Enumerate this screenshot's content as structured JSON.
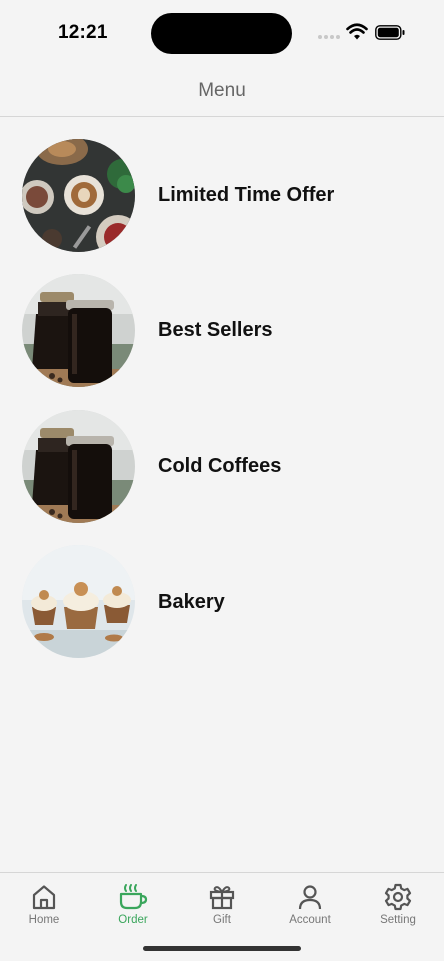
{
  "status_bar": {
    "time": "12:21"
  },
  "header": {
    "title": "Menu"
  },
  "menu": {
    "items": [
      {
        "label": "Limited Time Offer",
        "image": "coffee-table-photo"
      },
      {
        "label": "Best Sellers",
        "image": "cold-brew-jars-photo"
      },
      {
        "label": "Cold Coffees",
        "image": "cold-brew-jars-photo"
      },
      {
        "label": "Bakery",
        "image": "cupcakes-photo"
      }
    ]
  },
  "tab_bar": {
    "active": "Order",
    "accent_color": "#3aa65c",
    "tabs": [
      {
        "label": "Home",
        "icon": "home-icon"
      },
      {
        "label": "Order",
        "icon": "coffee-cup-icon"
      },
      {
        "label": "Gift",
        "icon": "gift-icon"
      },
      {
        "label": "Account",
        "icon": "person-icon"
      },
      {
        "label": "Setting",
        "icon": "gear-icon"
      }
    ]
  }
}
